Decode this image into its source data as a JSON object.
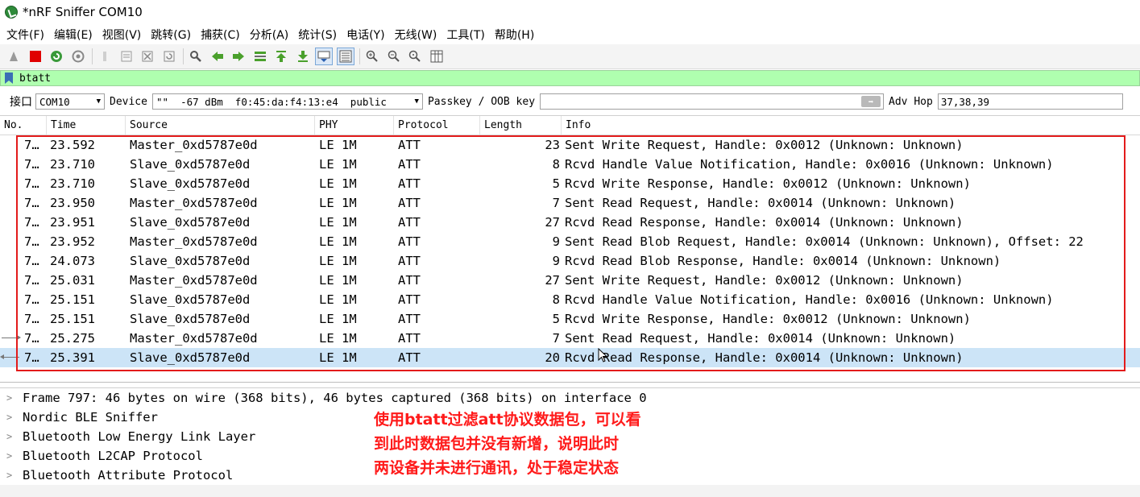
{
  "window": {
    "title": "*nRF Sniffer COM10"
  },
  "menu": [
    "文件(F)",
    "编辑(E)",
    "视图(V)",
    "跳转(G)",
    "捕获(C)",
    "分析(A)",
    "统计(S)",
    "电话(Y)",
    "无线(W)",
    "工具(T)",
    "帮助(H)"
  ],
  "filter": {
    "value": "btatt"
  },
  "interface_bar": {
    "iface_label": "接口",
    "iface_value": "COM10",
    "device_label": "Device",
    "device_value": "\"\"  -67 dBm  f0:45:da:f4:13:e4  public",
    "passkey_label": "Passkey / OOB key",
    "passkey_value": "",
    "adv_hop_label": "Adv Hop",
    "adv_hop_value": "37,38,39"
  },
  "columns": [
    "No.",
    "Time",
    "Source",
    "PHY",
    "Protocol",
    "Length",
    "Info"
  ],
  "packets": [
    {
      "no": "7…",
      "time": "23.592",
      "source": "Master_0xd5787e0d",
      "phy": "LE 1M",
      "protocol": "ATT",
      "length": "23",
      "info": "Sent Write Request, Handle: 0x0012 (Unknown: Unknown)"
    },
    {
      "no": "7…",
      "time": "23.710",
      "source": "Slave_0xd5787e0d",
      "phy": "LE 1M",
      "protocol": "ATT",
      "length": "8",
      "info": "Rcvd Handle Value Notification, Handle: 0x0016 (Unknown: Unknown)"
    },
    {
      "no": "7…",
      "time": "23.710",
      "source": "Slave_0xd5787e0d",
      "phy": "LE 1M",
      "protocol": "ATT",
      "length": "5",
      "info": "Rcvd Write Response, Handle: 0x0012 (Unknown: Unknown)"
    },
    {
      "no": "7…",
      "time": "23.950",
      "source": "Master_0xd5787e0d",
      "phy": "LE 1M",
      "protocol": "ATT",
      "length": "7",
      "info": "Sent Read Request, Handle: 0x0014 (Unknown: Unknown)"
    },
    {
      "no": "7…",
      "time": "23.951",
      "source": "Slave_0xd5787e0d",
      "phy": "LE 1M",
      "protocol": "ATT",
      "length": "27",
      "info": "Rcvd Read Response, Handle: 0x0014 (Unknown: Unknown)"
    },
    {
      "no": "7…",
      "time": "23.952",
      "source": "Master_0xd5787e0d",
      "phy": "LE 1M",
      "protocol": "ATT",
      "length": "9",
      "info": "Sent Read Blob Request, Handle: 0x0014 (Unknown: Unknown), Offset: 22"
    },
    {
      "no": "7…",
      "time": "24.073",
      "source": "Slave_0xd5787e0d",
      "phy": "LE 1M",
      "protocol": "ATT",
      "length": "9",
      "info": "Rcvd Read Blob Response, Handle: 0x0014 (Unknown: Unknown)"
    },
    {
      "no": "7…",
      "time": "25.031",
      "source": "Master_0xd5787e0d",
      "phy": "LE 1M",
      "protocol": "ATT",
      "length": "27",
      "info": "Sent Write Request, Handle: 0x0012 (Unknown: Unknown)"
    },
    {
      "no": "7…",
      "time": "25.151",
      "source": "Slave_0xd5787e0d",
      "phy": "LE 1M",
      "protocol": "ATT",
      "length": "8",
      "info": "Rcvd Handle Value Notification, Handle: 0x0016 (Unknown: Unknown)"
    },
    {
      "no": "7…",
      "time": "25.151",
      "source": "Slave_0xd5787e0d",
      "phy": "LE 1M",
      "protocol": "ATT",
      "length": "5",
      "info": "Rcvd Write Response, Handle: 0x0012 (Unknown: Unknown)"
    },
    {
      "no": "7…",
      "time": "25.275",
      "source": "Master_0xd5787e0d",
      "phy": "LE 1M",
      "protocol": "ATT",
      "length": "7",
      "info": "Sent Read Request, Handle: 0x0014 (Unknown: Unknown)"
    },
    {
      "no": "7…",
      "time": "25.391",
      "source": "Slave_0xd5787e0d",
      "phy": "LE 1M",
      "protocol": "ATT",
      "length": "20",
      "info": "Rcvd Read Response, Handle: 0x0014 (Unknown: Unknown)"
    }
  ],
  "details": [
    "Frame 797: 46 bytes on wire (368 bits), 46 bytes captured (368 bits) on interface 0",
    "Nordic BLE Sniffer",
    "Bluetooth Low Energy Link Layer",
    "Bluetooth L2CAP Protocol",
    "Bluetooth Attribute Protocol"
  ],
  "annotation": [
    "使用btatt过滤att协议数据包，可以看",
    "到此时数据包并没有新增，说明此时",
    "两设备并未进行通讯，处于稳定状态"
  ],
  "colors": {
    "filter_bg": "#afffaf",
    "selected_row": "#cce4f7",
    "annotation": "#ff1a1a"
  }
}
